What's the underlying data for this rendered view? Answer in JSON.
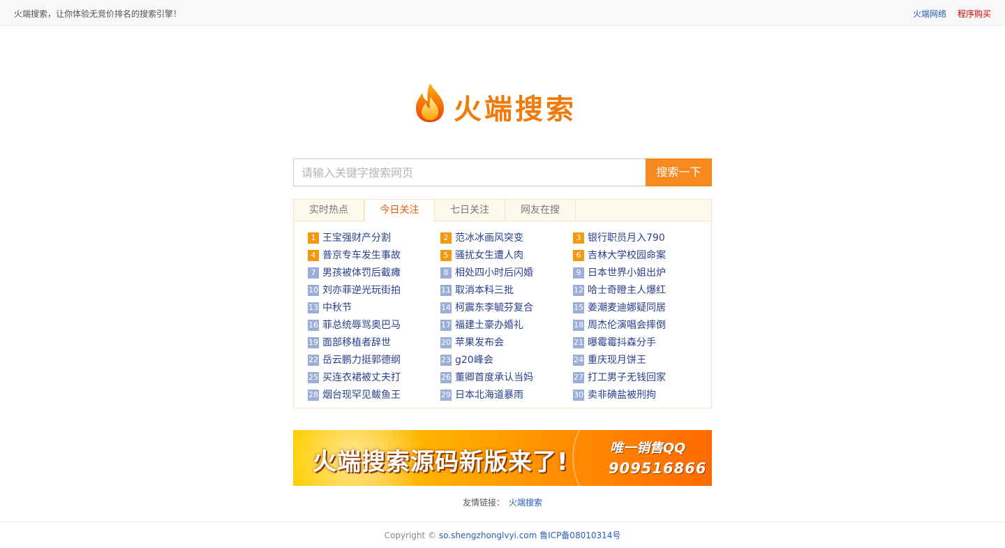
{
  "topbar": {
    "slogan": "火端搜索，让你体验无竞价排名的搜索引擎！",
    "link_network": "火端网络",
    "link_buy": "程序购买"
  },
  "logo": {
    "text": "火端搜索",
    "icon": "flame-icon"
  },
  "search": {
    "placeholder": "请输入关键字搜索网页",
    "value": "",
    "button_label": "搜索一下"
  },
  "tabs": [
    {
      "label": "实时热点",
      "active": false
    },
    {
      "label": "今日关注",
      "active": true
    },
    {
      "label": "七日关注",
      "active": false
    },
    {
      "label": "网友在搜",
      "active": false
    }
  ],
  "hot_items": [
    {
      "rank": "1",
      "text": "王宝强财产分割"
    },
    {
      "rank": "2",
      "text": "范冰冰画风突变"
    },
    {
      "rank": "3",
      "text": "银行职员月入790"
    },
    {
      "rank": "4",
      "text": "普京专车发生事故"
    },
    {
      "rank": "5",
      "text": "骚扰女生遭人肉"
    },
    {
      "rank": "6",
      "text": "吉林大学校园命案"
    },
    {
      "rank": "7",
      "text": "男孩被体罚后截瘫"
    },
    {
      "rank": "8",
      "text": "相处四小时后闪婚"
    },
    {
      "rank": "9",
      "text": "日本世界小姐出炉"
    },
    {
      "rank": "10",
      "text": "刘亦菲逆光玩街拍"
    },
    {
      "rank": "11",
      "text": "取消本科三批"
    },
    {
      "rank": "12",
      "text": "哈士奇瞪主人爆红"
    },
    {
      "rank": "13",
      "text": "中秋节"
    },
    {
      "rank": "14",
      "text": "柯震东李毓芬复合"
    },
    {
      "rank": "15",
      "text": "姜潮麦迪娜疑同居"
    },
    {
      "rank": "16",
      "text": "菲总统辱骂奥巴马"
    },
    {
      "rank": "17",
      "text": "福建土豪办婚礼"
    },
    {
      "rank": "18",
      "text": "周杰伦演唱会摔倒"
    },
    {
      "rank": "19",
      "text": "面部移植者辞世"
    },
    {
      "rank": "20",
      "text": "苹果发布会"
    },
    {
      "rank": "21",
      "text": "曝霉霉抖森分手"
    },
    {
      "rank": "22",
      "text": "岳云鹏力挺郭德纲"
    },
    {
      "rank": "23",
      "text": "g20峰会"
    },
    {
      "rank": "24",
      "text": "重庆现月饼王"
    },
    {
      "rank": "25",
      "text": "买连衣裙被丈夫打"
    },
    {
      "rank": "26",
      "text": "董卿首度承认当妈"
    },
    {
      "rank": "27",
      "text": "打工男子无钱回家"
    },
    {
      "rank": "28",
      "text": "烟台现罕见鲅鱼王"
    },
    {
      "rank": "29",
      "text": "日本北海道暴雨"
    },
    {
      "rank": "30",
      "text": "卖非碘盐被刑拘"
    }
  ],
  "banner": {
    "title": "火端搜索源码新版来了!",
    "qq_label": "唯一销售QQ",
    "qq_number": "909516866"
  },
  "friends": {
    "label": "友情链接：",
    "link": "火端搜索"
  },
  "footer": {
    "copyright": "Copyright ©",
    "domain": "so.shengzhonglvyi.com",
    "icp": "鲁ICP备08010314号"
  },
  "colors": {
    "accent": "#f7891e",
    "link": "#2a3f8f",
    "rank_top": "#f6980c",
    "rank_other": "#9aaed8"
  }
}
